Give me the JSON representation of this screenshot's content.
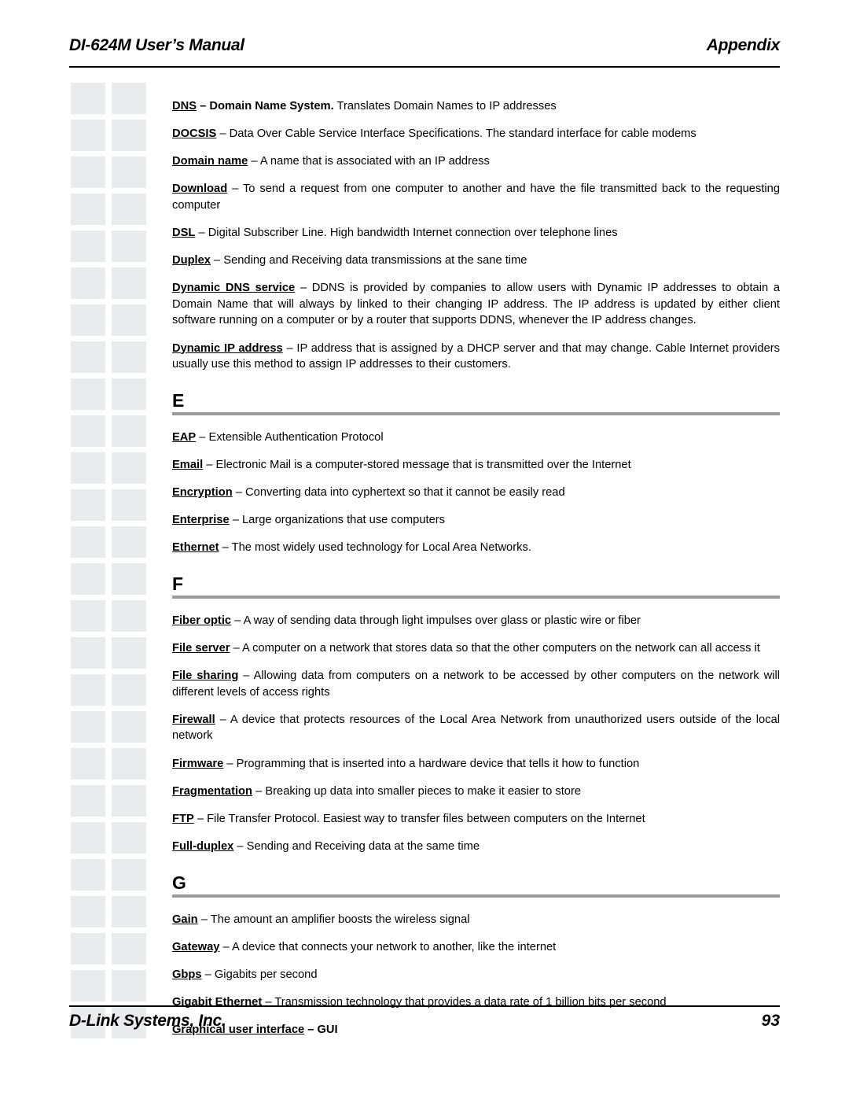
{
  "header": {
    "manual_title": "DI-624M User’s Manual",
    "section_title": "Appendix"
  },
  "footer": {
    "company": "D-Link Systems, Inc.",
    "page_number": "93"
  },
  "content": [
    {
      "kind": "entry",
      "term": "DNS",
      "definition": " – Domain Name System.  Translates Domain Names to IP addresses",
      "term_bold_tail": " – Domain Name System."
    },
    {
      "kind": "entry",
      "term": "DOCSIS",
      "definition": " – Data Over Cable Service Interface Specifications.  The standard interface for cable modems"
    },
    {
      "kind": "entry",
      "term": "Domain name",
      "definition": " – A name that is associated with an IP address"
    },
    {
      "kind": "entry",
      "term": "Download",
      "definition": " – To send a request from one computer to another and have the file transmitted back to the requesting computer"
    },
    {
      "kind": "entry",
      "term": "DSL",
      "definition": " – Digital Subscriber Line.  High bandwidth Internet connection over telephone lines"
    },
    {
      "kind": "entry",
      "term": "Duplex",
      "definition": " – Sending and Receiving data transmissions at the sane time"
    },
    {
      "kind": "entry",
      "term": "Dynamic DNS service",
      "definition": " – DDNS is provided by companies to allow users with Dynamic IP addresses to obtain a Domain Name that will always by linked to their changing IP address.  The IP address is updated by either client software running on a computer or by a router that supports DDNS, whenever the IP address changes."
    },
    {
      "kind": "entry",
      "term": "Dynamic IP address",
      "definition": " – IP address that is assigned by a DHCP server and that may change.  Cable Internet providers usually use this method to assign IP addresses to their customers."
    },
    {
      "kind": "section",
      "letter": "E"
    },
    {
      "kind": "entry",
      "term": "EAP",
      "definition": " – Extensible Authentication Protocol"
    },
    {
      "kind": "entry",
      "term": "Email",
      "definition": " – Electronic Mail is a computer-stored message that is transmitted over the Internet"
    },
    {
      "kind": "entry",
      "term": "Encryption",
      "definition": " – Converting data into cyphertext so that it cannot be easily read"
    },
    {
      "kind": "entry",
      "term": "Enterprise",
      "definition": " – Large organizations that use computers"
    },
    {
      "kind": "entry",
      "term": "Ethernet",
      "definition": " – The most widely used technology for Local Area Networks."
    },
    {
      "kind": "section",
      "letter": "F"
    },
    {
      "kind": "entry",
      "term": "Fiber optic",
      "definition": " – A way of sending data through light impulses over glass or plastic wire or fiber"
    },
    {
      "kind": "entry",
      "term": "File server",
      "definition": " – A computer on a network that stores data so that the other computers on the network can all access it"
    },
    {
      "kind": "entry",
      "term": "File sharing",
      "definition": " – Allowing data from computers on a network to be accessed by other computers on the network will different levels of access rights"
    },
    {
      "kind": "entry",
      "term": "Firewall",
      "definition": " – A device that protects resources of the Local Area Network from unauthorized users outside of the local network"
    },
    {
      "kind": "entry",
      "term": "Firmware",
      "definition": " – Programming that is inserted into a hardware device that tells it how to function"
    },
    {
      "kind": "entry",
      "term": "Fragmentation",
      "definition": " – Breaking up data into smaller pieces to make it easier to store"
    },
    {
      "kind": "entry",
      "term": "FTP",
      "definition": " – File Transfer Protocol.  Easiest way to transfer files between computers on the Internet"
    },
    {
      "kind": "entry",
      "term": "Full-duplex",
      "definition": " – Sending and Receiving data at the same time"
    },
    {
      "kind": "section",
      "letter": "G"
    },
    {
      "kind": "entry",
      "term": "Gain",
      "definition": " – The amount an amplifier boosts the wireless signal"
    },
    {
      "kind": "entry",
      "term": "Gateway",
      "definition": " – A device that connects your network to another, like the internet"
    },
    {
      "kind": "entry",
      "term": "Gbps",
      "definition": " – Gigabits per second"
    },
    {
      "kind": "entry",
      "term": "Gigabit Ethernet",
      "definition": " – Transmission technology that provides a data rate of 1 billion bits per second"
    },
    {
      "kind": "entry",
      "term": "Graphical user interface",
      "definition": " – GUI",
      "all_bold": true
    }
  ],
  "decoration": {
    "square_color": "#e9ebec",
    "left_column_count": 26,
    "right_column_count": 26
  }
}
